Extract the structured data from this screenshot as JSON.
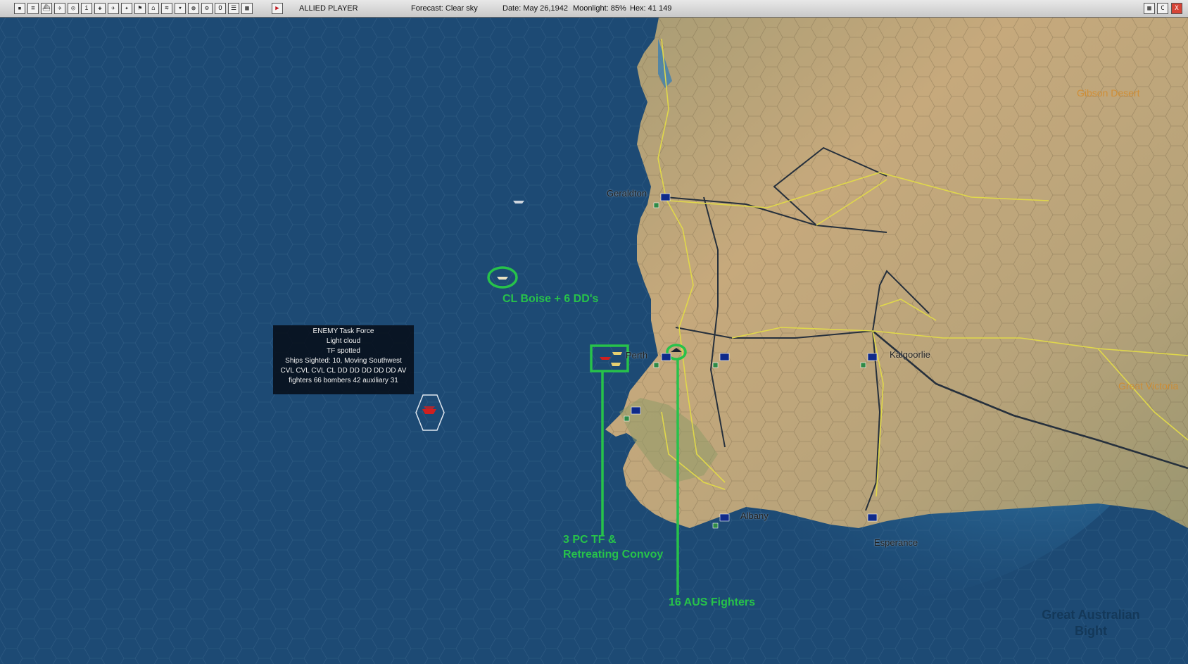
{
  "toolbar": {
    "icons": [
      "save-icon",
      "report-icon",
      "ship-icon",
      "air-icon",
      "intel-icon",
      "info-icon",
      "base-icon",
      "aircraft-icon",
      "bomber-icon",
      "flag-icon",
      "landing-icon",
      "tf-icon",
      "sub-icon",
      "globe-icon",
      "settings-icon",
      "ob-icon",
      "list-icon",
      "map-icon"
    ],
    "end_turn_icon": "play-icon",
    "player": "ALLIED PLAYER",
    "forecast": "Forecast: Clear sky",
    "date": "Date: May 26,1942",
    "moonlight": "Moonlight: 85%",
    "hex": "Hex: 41 149",
    "window_buttons": [
      "map-icon",
      "C",
      "X"
    ]
  },
  "map": {
    "cities": {
      "geraldton": "Geraldton",
      "perth": "Perth",
      "kalgoorlie": "Kalgoorlie",
      "albany": "Albany",
      "esperance": "Esperance"
    },
    "regions": {
      "gibson": "Gibson Desert",
      "victoria": "Great Victoria",
      "bight": "Great Australian Bight"
    }
  },
  "enemy_popup": {
    "title": "ENEMY Task Force",
    "weather": "Light cloud",
    "status": "TF spotted",
    "sighted": "Ships Sighted: 10, Moving Southwest",
    "ships": "CVL CVL CVL CL DD DD DD DD DD AV",
    "aircraft": "fighters 66  bombers 42  auxiliary 31"
  },
  "annotations": {
    "boise": "CL Boise + 6 DD's",
    "convoy_line1": "3 PC TF &",
    "convoy_line2": "Retreating Convoy",
    "fighters": "16 AUS Fighters"
  },
  "colors": {
    "ocean": "#1d4a74",
    "land": "#b8a77c",
    "annotation": "#27c24a",
    "road": "#e0d84a",
    "rail": "#26303c"
  }
}
